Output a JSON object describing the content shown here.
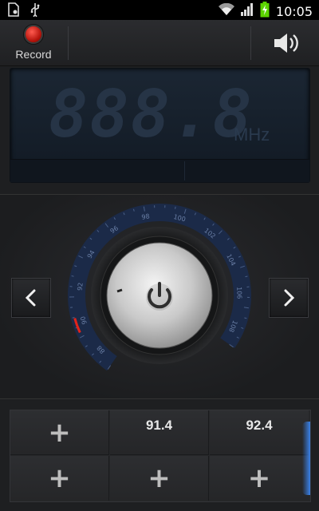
{
  "status_bar": {
    "time": "10:05",
    "icons": [
      "file-notification-icon",
      "usb-icon",
      "wifi-icon",
      "signal-icon",
      "battery-charging-icon"
    ],
    "battery_color": "#5cd400"
  },
  "toolbar": {
    "record_label": "Record",
    "record_color": "#d71a10",
    "speaker_icon": "speaker-icon"
  },
  "display": {
    "frequency": "888.8",
    "unit": "MHz"
  },
  "tuner": {
    "scale_labels": [
      "88",
      "90",
      "92",
      "94",
      "96",
      "98",
      "100",
      "102",
      "104",
      "106",
      "108"
    ],
    "prev_icon": "chevron-left-icon",
    "next_icon": "chevron-right-icon",
    "power_icon": "power-icon"
  },
  "presets": [
    {
      "label": "+"
    },
    {
      "label": "91.4"
    },
    {
      "label": "92.4"
    },
    {
      "label": "+"
    },
    {
      "label": "+"
    },
    {
      "label": "+"
    }
  ],
  "accent_color": "#3c8cff"
}
